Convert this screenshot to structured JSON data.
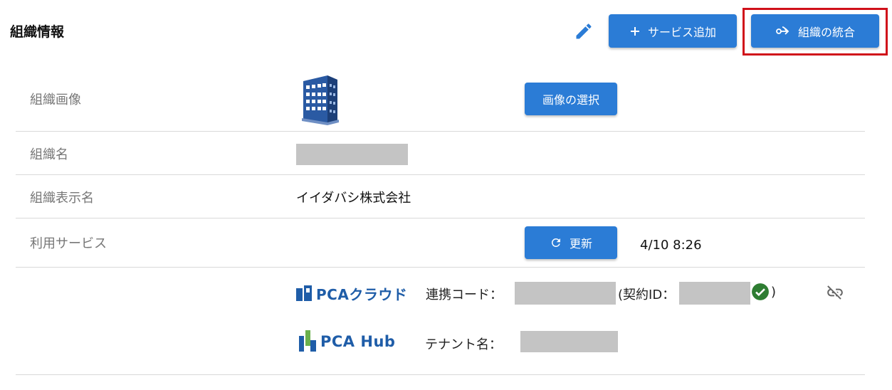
{
  "header": {
    "title": "組織情報",
    "add_service_label": "サービス追加",
    "merge_org_label": "組織の統合"
  },
  "rows": {
    "image_label": "組織画像",
    "select_image_label": "画像の選択",
    "name_label": "組織名",
    "display_name_label": "組織表示名",
    "display_name_value": "イイダバシ株式会社",
    "services_label": "利用サービス",
    "refresh_label": "更新",
    "updated_time": "4/10 8:26"
  },
  "services": {
    "pca_cloud": {
      "logo_text": "PCAクラウド",
      "code_label": "連携コード：",
      "contract_open": "(契約ID：",
      "contract_close": ")"
    },
    "pca_hub": {
      "logo_text": "PCA Hub",
      "tenant_label": "テナント名："
    }
  },
  "colors": {
    "accent": "#2b7cd6",
    "highlight": "#d0101a",
    "success": "#2e7d32",
    "brand": "#1f5da8"
  },
  "icons": [
    "pencil-icon",
    "plus-icon",
    "merge-icon",
    "building-icon",
    "refresh-icon",
    "check-circle-icon",
    "unlink-icon"
  ]
}
